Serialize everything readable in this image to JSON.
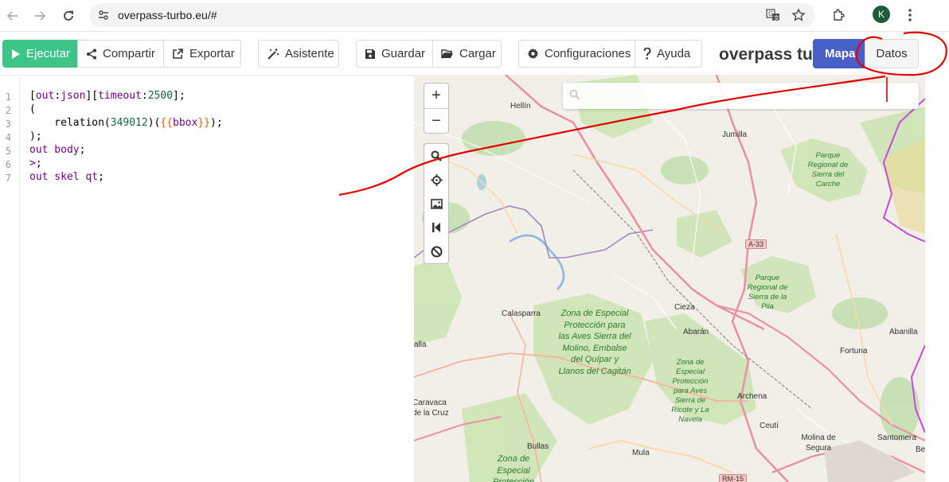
{
  "browser": {
    "url": "overpass-turbo.eu/#",
    "avatar_letter": "K"
  },
  "toolbar": {
    "run": "Ejecutar",
    "share": "Compartir",
    "export": "Exportar",
    "wizard": "Asistente",
    "save": "Guardar",
    "load": "Cargar",
    "settings": "Configuraciones",
    "help": "Ayuda",
    "logo": "overpass turbo",
    "tab_map": "Mapa",
    "tab_data": "Datos"
  },
  "editor": {
    "line_numbers": [
      "1",
      "2",
      "3",
      "4",
      "5",
      "6",
      "7"
    ],
    "lines": [
      [
        {
          "t": "[",
          "c": "p"
        },
        {
          "t": "out",
          "c": "kw"
        },
        {
          "t": ":",
          "c": "p"
        },
        {
          "t": "json",
          "c": "kw"
        },
        {
          "t": "][",
          "c": "p"
        },
        {
          "t": "timeout",
          "c": "kw"
        },
        {
          "t": ":",
          "c": "p"
        },
        {
          "t": "2500",
          "c": "num"
        },
        {
          "t": "];",
          "c": "p"
        }
      ],
      [
        {
          "t": "(",
          "c": "p"
        }
      ],
      [
        {
          "t": "    relation(",
          "c": "p"
        },
        {
          "t": "349012",
          "c": "num"
        },
        {
          "t": ")(",
          "c": "p"
        },
        {
          "t": "{{",
          "c": "br"
        },
        {
          "t": "bbox",
          "c": "ph"
        },
        {
          "t": "}}",
          "c": "br"
        },
        {
          "t": ");",
          "c": "p"
        }
      ],
      [
        {
          "t": ");",
          "c": "p"
        }
      ],
      [
        {
          "t": "out body",
          "c": "kw"
        },
        {
          "t": ";",
          "c": "p"
        }
      ],
      [
        {
          "t": ">",
          "c": "kw"
        },
        {
          "t": ";",
          "c": "p"
        }
      ],
      [
        {
          "t": "out skel qt",
          "c": "kw"
        },
        {
          "t": ";",
          "c": "p"
        }
      ]
    ]
  },
  "map": {
    "zoom_in": "+",
    "zoom_out": "−",
    "search_placeholder": "",
    "places": [
      {
        "name": "Hellín"
      },
      {
        "name": "Jumilla"
      },
      {
        "name": "Calasparra"
      },
      {
        "name": "Cieza"
      },
      {
        "name": "Abarán"
      },
      {
        "name": "Abanilla"
      },
      {
        "name": "Fortuna"
      },
      {
        "name": "Archena"
      },
      {
        "name": "Ceutí"
      },
      {
        "name": "Molina de Segura"
      },
      {
        "name": "Santomera"
      },
      {
        "name": "Bullas"
      },
      {
        "name": "Mula"
      },
      {
        "name": "Caravaca de la Cruz"
      },
      {
        "name": "Be"
      },
      {
        "name": "alla"
      }
    ],
    "parks": [
      "Parque Regional de Sierra del Carche",
      "Parque Regional de Sierra de la Pila",
      "Zona de Especial Protección para las Aves Sierra del Molino, Embalse del Quípar y Llanos del Cagitán",
      "Zona de Especial Protección para Aves Sierra de Ricote y La Navela",
      "Zona de Especial Protección"
    ],
    "roads": [
      "A-33",
      "RM-15"
    ]
  },
  "colors": {
    "run_green": "#3ec487",
    "map_tab_blue": "#485fc7",
    "annotation_red": "#e00000"
  }
}
